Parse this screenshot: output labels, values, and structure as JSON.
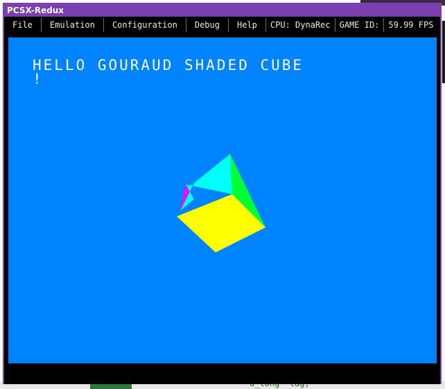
{
  "window": {
    "title": "PCSX-Redux",
    "accent_color": "#7b3fb0"
  },
  "menubar": {
    "items": [
      {
        "label": "File"
      },
      {
        "label": "Emulation"
      },
      {
        "label": "Configuration"
      },
      {
        "label": "Debug"
      },
      {
        "label": "Help"
      }
    ],
    "cpu_status": "CPU: DynaRec",
    "game_id": "GAME ID:",
    "fps": "59.99 FPS"
  },
  "screen": {
    "background_color": "#0083ff",
    "text_line1": "HELLO GOURAUD SHADED CUBE",
    "text_line2": "!",
    "cube_face_colors": {
      "front": "#ffff00",
      "top": "#00ffff",
      "right": "#00ff33",
      "left": "#ff00ff"
    }
  },
  "background": {
    "code_fragment": "u_long  tag;"
  }
}
